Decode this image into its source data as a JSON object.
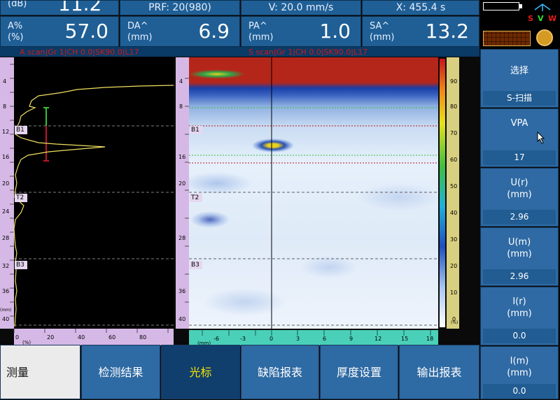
{
  "header": {
    "db_label": "(dB)",
    "db_value": "11.2",
    "prf": "PRF: 20(980)",
    "velocity": "V: 20.0 mm/s",
    "x_readout": "X: 455.4  s",
    "cells": [
      {
        "label": "A%",
        "unit": "(%)",
        "value": "57.0"
      },
      {
        "label": "DA^",
        "unit": "(mm)",
        "value": "6.9"
      },
      {
        "label": "PA^",
        "unit": "(mm)",
        "value": "1.0"
      },
      {
        "label": "SA^",
        "unit": "(mm)",
        "value": "13.2"
      }
    ],
    "status_letters": {
      "s": "S",
      "v": "V",
      "w": "W"
    }
  },
  "scan_labels": {
    "a_scan": "A scan|Gr 1|CH 0.0|SK90.0|L17",
    "s_scan": "S scan|Gr 1|CH 0.0|SK90.0|L17"
  },
  "gates": [
    "B1",
    "T2",
    "B3"
  ],
  "depth_ticks": [
    "4",
    "8",
    "12",
    "16",
    "20",
    "24",
    "28",
    "32",
    "36",
    "40"
  ],
  "depth_unit": "(mm)",
  "amp_ticks": [
    "0",
    "20",
    "40",
    "60",
    "80"
  ],
  "amp_unit": "(%)",
  "scan_ticks": [
    "-6",
    "-3",
    "0",
    "3",
    "6",
    "9",
    "12",
    "15",
    "18"
  ],
  "scan_unit": "(mm)",
  "color_ticks": [
    "90",
    "80",
    "70",
    "60",
    "50",
    "40",
    "30",
    "20",
    "10",
    "0"
  ],
  "color_unit": "(%)",
  "side_menu": [
    {
      "label": "选择",
      "value": "S-扫描"
    },
    {
      "label": "VPA",
      "value": "17"
    },
    {
      "label": "U(r)\n(mm)",
      "value": "2.96"
    },
    {
      "label": "U(m)\n(mm)",
      "value": "2.96"
    },
    {
      "label": "I(r)\n(mm)",
      "value": "0.0"
    },
    {
      "label": "I(m)\n(mm)",
      "value": "0.0"
    }
  ],
  "tabs": [
    "测量",
    "检测结果",
    "光标",
    "缺陷报表",
    "厚度设置",
    "输出报表"
  ],
  "active_tab": "光标",
  "colors": {
    "accent": "#1f5f95",
    "active_tab": "#103f6e",
    "active_text": "#f3e200",
    "gate_red": "#c0142a",
    "gate_green": "#3fbf3f"
  }
}
